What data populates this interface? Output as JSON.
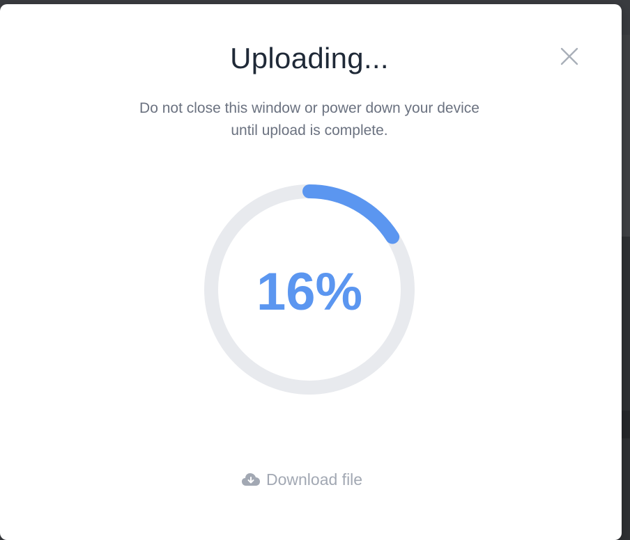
{
  "modal": {
    "title": "Uploading...",
    "message_line1": "Do not close this window or power down your device",
    "message_line2": "until upload is complete.",
    "close_icon": "close-icon"
  },
  "progress": {
    "percent_label": "16%",
    "value": 0.16,
    "track_color": "#e8eaee",
    "fill_color": "#5b96f0"
  },
  "download": {
    "icon": "cloud-download-icon",
    "label": "Download file"
  }
}
